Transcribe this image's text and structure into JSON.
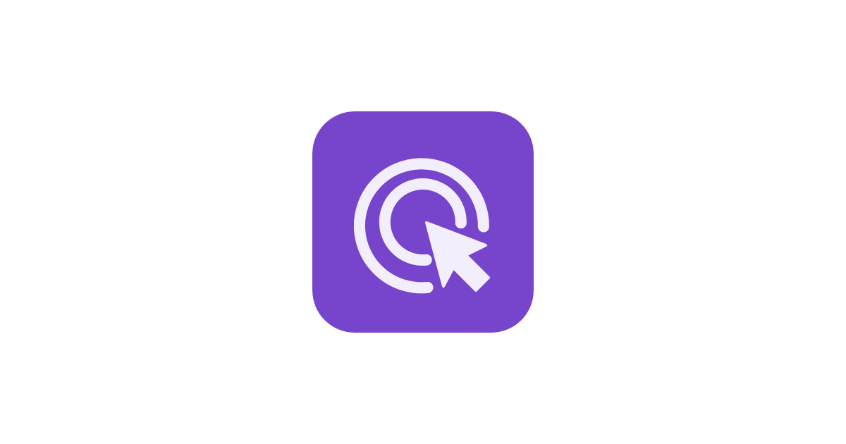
{
  "icon": {
    "name": "click-target-cursor-icon",
    "background_color": "#7744CC",
    "glyph_color": "#F3EEFC"
  }
}
